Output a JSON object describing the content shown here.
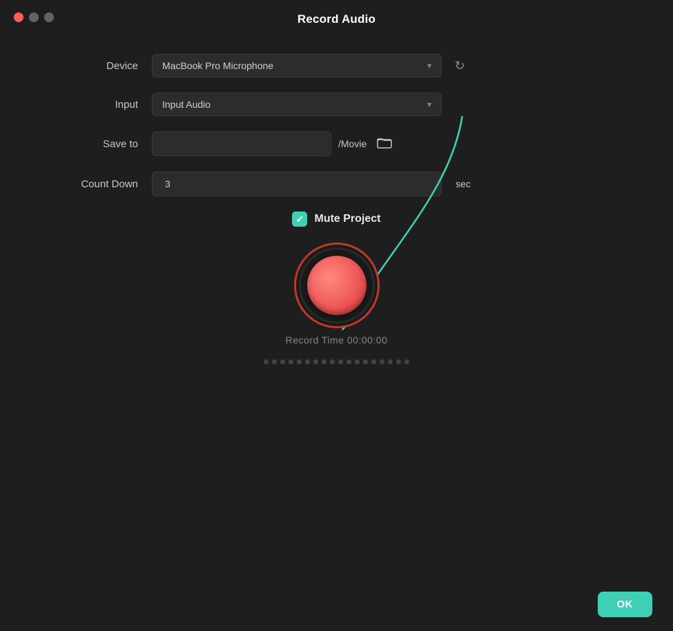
{
  "window": {
    "title": "Record Audio",
    "controls": {
      "close": "close",
      "minimize": "minimize",
      "maximize": "maximize"
    }
  },
  "form": {
    "device_label": "Device",
    "device_value": "MacBook Pro Microphone",
    "device_placeholder": "MacBook Pro Microphone",
    "input_label": "Input",
    "input_value": "Input Audio",
    "save_to_label": "Save to",
    "save_to_path": "/Movie",
    "countdown_label": "Count Down",
    "countdown_value": "3",
    "countdown_unit": "sec"
  },
  "mute": {
    "label": "Mute Project",
    "checked": true
  },
  "record": {
    "time_label": "Record Time 00:00:00"
  },
  "buttons": {
    "ok": "OK"
  },
  "icons": {
    "chevron": "▾",
    "refresh": "↻",
    "folder": "🗂",
    "checkmark": "✓"
  },
  "waveform_dots": 18
}
